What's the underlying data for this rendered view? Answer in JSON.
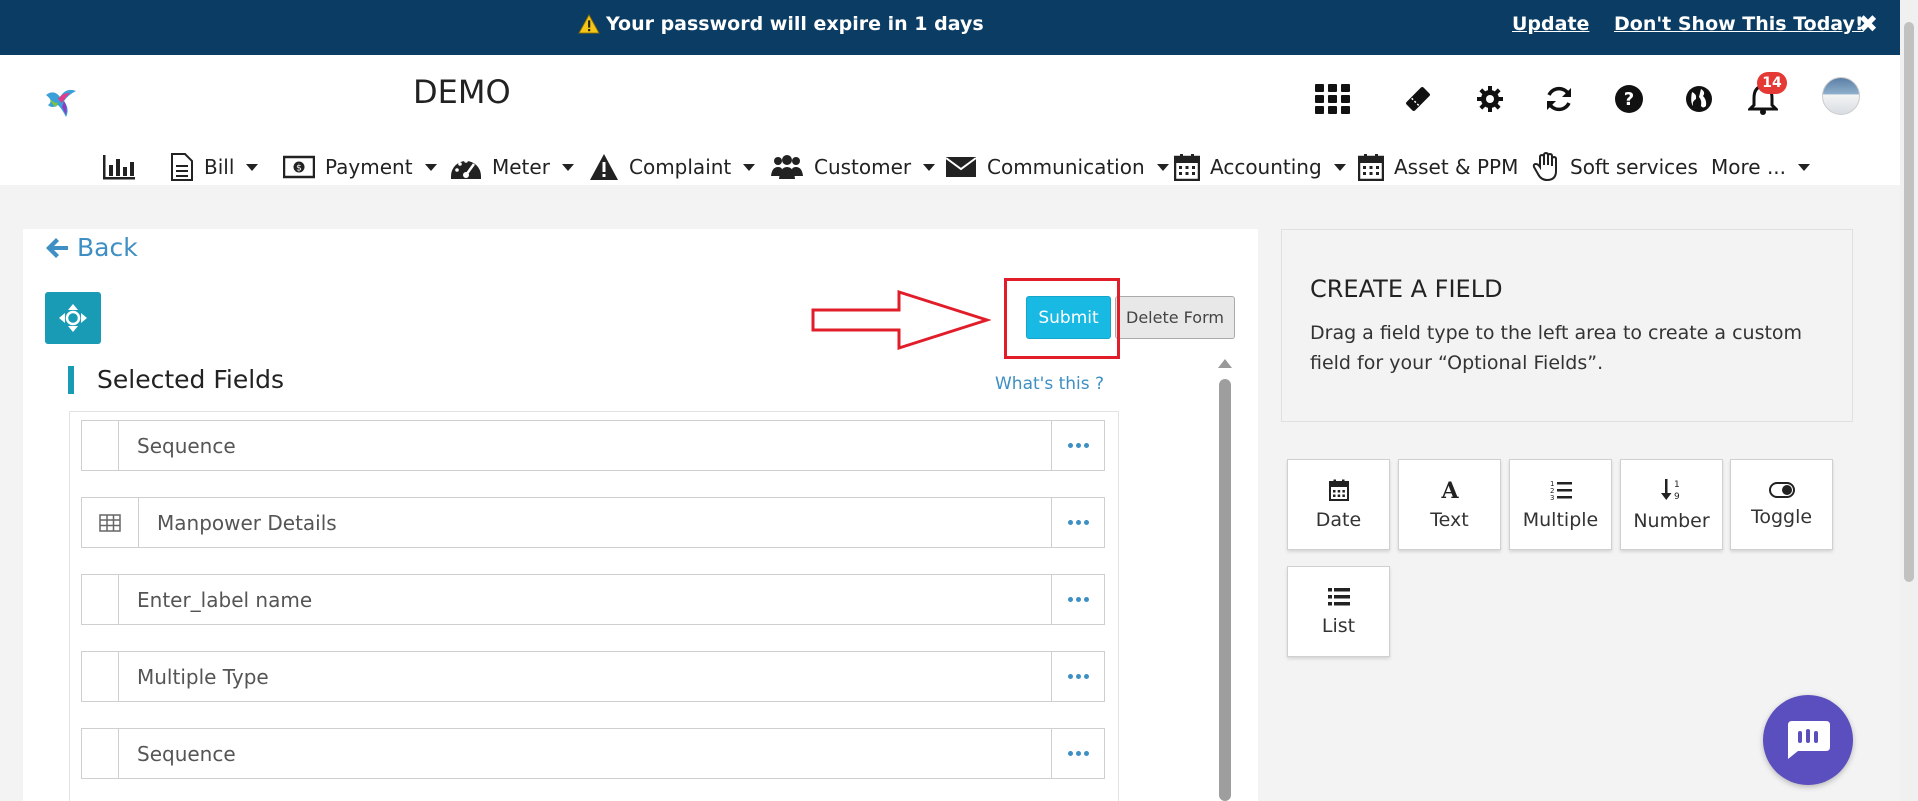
{
  "banner": {
    "message": "Your password will expire in 1 days",
    "update_label": "Update",
    "dont_show_label": "Don't Show This Today!",
    "close_glyph": "✖"
  },
  "header": {
    "title": "DEMO",
    "notification_count": "14",
    "top_icons": [
      "apps-grid-icon",
      "ticket-icon",
      "gear-icon",
      "refresh-icon",
      "help-icon",
      "globe-icon",
      "bell-icon"
    ]
  },
  "nav": {
    "items": [
      {
        "label": "",
        "icon": "bar-chart-icon",
        "dropdown": false
      },
      {
        "label": "Bill",
        "icon": "document-icon",
        "dropdown": true
      },
      {
        "label": "Payment",
        "icon": "money-icon",
        "dropdown": true
      },
      {
        "label": "Meter",
        "icon": "gauge-icon",
        "dropdown": true
      },
      {
        "label": "Complaint",
        "icon": "warning-icon",
        "dropdown": true
      },
      {
        "label": "Customer",
        "icon": "users-icon",
        "dropdown": true
      },
      {
        "label": "Communication",
        "icon": "envelope-icon",
        "dropdown": true
      },
      {
        "label": "Accounting",
        "icon": "calendar-icon",
        "dropdown": true
      },
      {
        "label": "Asset & PPM",
        "icon": "calendar-icon",
        "dropdown": false
      },
      {
        "label": "Soft services",
        "icon": "hand-icon",
        "dropdown": false
      },
      {
        "label": "More ...",
        "icon": "",
        "dropdown": true
      }
    ]
  },
  "main": {
    "back_label": "Back",
    "submit_label": "Submit",
    "delete_label": "Delete Form",
    "selected_title": "Selected Fields",
    "whats_this": "What's this ?",
    "fields": [
      {
        "label": "Sequence",
        "icon": ""
      },
      {
        "label": "Manpower Details",
        "icon": "table-icon"
      },
      {
        "label": "Enter_label name",
        "icon": ""
      },
      {
        "label": "Multiple Type",
        "icon": ""
      },
      {
        "label": "Sequence",
        "icon": ""
      }
    ]
  },
  "side": {
    "title": "CREATE A FIELD",
    "description": "Drag a field type to the left area to create a custom field for your “Optional Fields”.",
    "types": [
      {
        "label": "Date",
        "icon": "calendar-icon"
      },
      {
        "label": "Text",
        "icon": "text-icon"
      },
      {
        "label": "Multiple",
        "icon": "numbered-list-icon"
      },
      {
        "label": "Number",
        "icon": "sort-numeric-icon"
      },
      {
        "label": "Toggle",
        "icon": "toggle-icon"
      },
      {
        "label": "List",
        "icon": "list-icon"
      }
    ]
  },
  "colors": {
    "banner_bg": "#0b3c64",
    "accent": "#1a9bb5",
    "submit": "#18b9e3",
    "link": "#3d8fc4",
    "annotation": "#e11d2a",
    "chat": "#5b4fbf"
  }
}
